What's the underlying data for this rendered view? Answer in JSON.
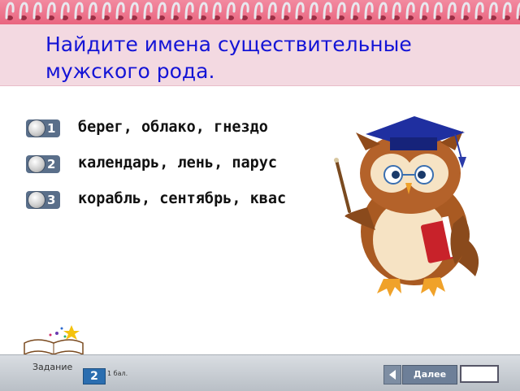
{
  "question": {
    "title": "Найдите имена существительные мужского рода."
  },
  "options": [
    {
      "number": "1",
      "text": "берег, облако, гнездо"
    },
    {
      "number": "2",
      "text": "календарь, лень, парус"
    },
    {
      "number": "3",
      "text": "корабль, сентябрь, квас"
    }
  ],
  "footer": {
    "task_label": "Задание",
    "task_number": "2",
    "points": "1 бал.",
    "next_label": "Далее"
  },
  "colors": {
    "title": "#1414d6",
    "header_pink": "#e9657f",
    "radio_bg": "#5a6f8a",
    "footer_bg": "#c8cdd3"
  },
  "icons": [
    "spiral-binding-icon",
    "owl-teacher-illustration",
    "open-book-stars-icon",
    "triangle-left-icon"
  ]
}
